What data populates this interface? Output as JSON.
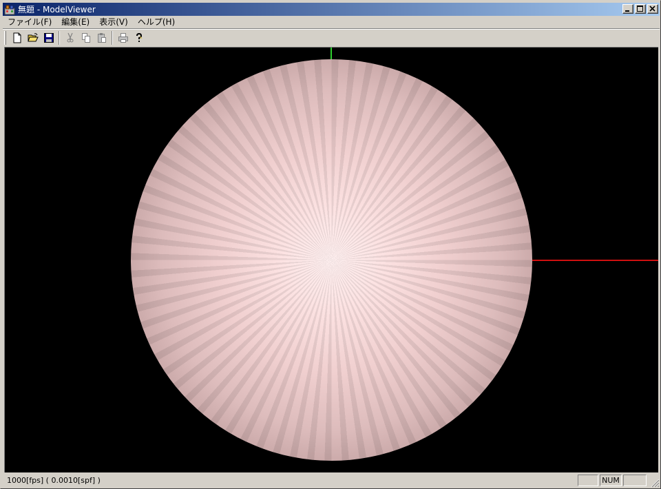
{
  "window": {
    "title": "無題 - ModelViewer",
    "app_icon": "modelviewer-app-icon"
  },
  "menu": [
    {
      "label": "ファイル(F)"
    },
    {
      "label": "編集(E)"
    },
    {
      "label": "表示(V)"
    },
    {
      "label": "ヘルプ(H)"
    }
  ],
  "toolbar": {
    "buttons": [
      {
        "icon": "new-document-icon",
        "enabled": true
      },
      {
        "icon": "open-folder-icon",
        "enabled": true
      },
      {
        "icon": "save-disk-icon",
        "enabled": true
      },
      {
        "icon": "cut-scissors-icon",
        "enabled": false
      },
      {
        "icon": "copy-icon",
        "enabled": false
      },
      {
        "icon": "paste-icon",
        "enabled": false
      },
      {
        "icon": "print-icon",
        "enabled": false
      },
      {
        "icon": "help-icon",
        "enabled": true
      }
    ]
  },
  "viewport": {
    "background": "#000000",
    "model": "sphere",
    "sphere_color": "#f5d6d6",
    "x_axis_color": "#d01010",
    "y_axis_color": "#2fd02f"
  },
  "status": {
    "text": "1000[fps] ( 0.0010[spf] )",
    "pane_cap": "",
    "pane_num": "NUM",
    "pane_scrl": ""
  }
}
